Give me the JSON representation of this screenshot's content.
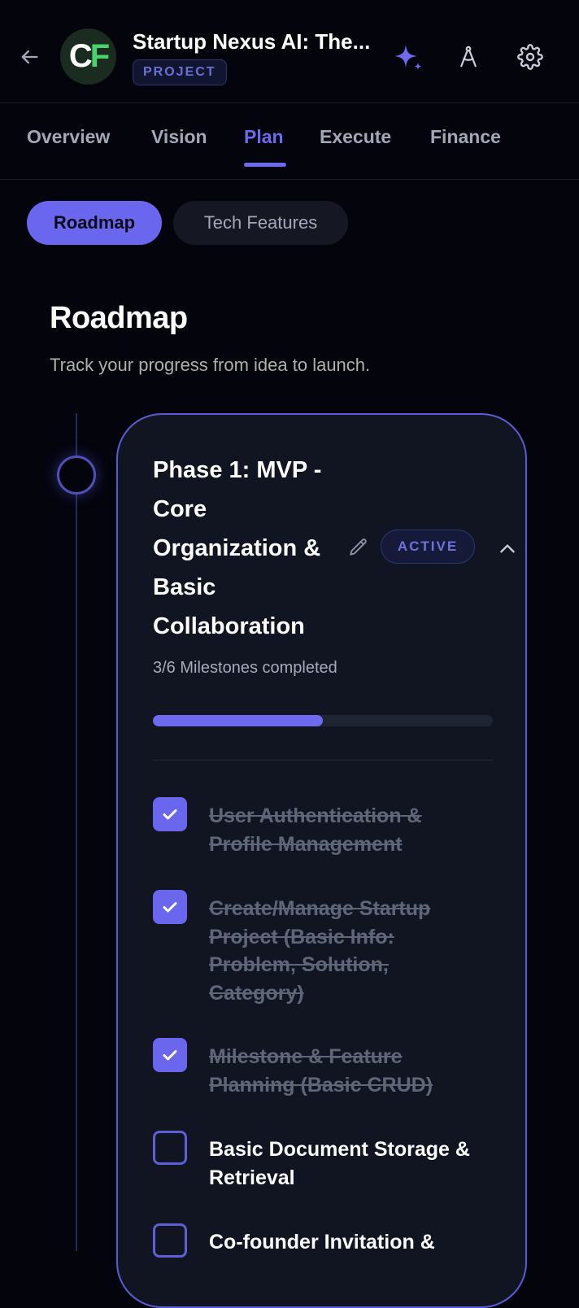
{
  "header": {
    "back_icon": "arrow-left-icon",
    "logo_letters": [
      "C",
      "F"
    ],
    "title": "Startup Nexus AI: The...",
    "badge": "PROJECT",
    "actions": [
      {
        "name": "ai-sparkle-icon",
        "color": "#6e6af0"
      },
      {
        "name": "compass-icon",
        "color": "#c9ccd8"
      },
      {
        "name": "gear-icon",
        "color": "#c9ccd8"
      }
    ]
  },
  "tabs": [
    "Overview",
    "Vision",
    "Plan",
    "Execute",
    "Finance"
  ],
  "active_tab": "Plan",
  "subtabs": [
    "Roadmap",
    "Tech Features"
  ],
  "active_subtab": "Roadmap",
  "section": {
    "title": "Roadmap",
    "subtitle": "Track your progress from idea to launch."
  },
  "phase": {
    "title": "Phase 1: MVP - Core Organization & Basic Collaboration",
    "status": "ACTIVE",
    "milestones_text": "3/6 Milestones completed",
    "progress": 0.5,
    "milestones": [
      {
        "label": "User Authentication & Profile Management",
        "done": true
      },
      {
        "label": "Create/Manage Startup Project (Basic Info: Problem, Solution, Category)",
        "done": true
      },
      {
        "label": "Milestone & Feature Planning (Basic CRUD)",
        "done": true
      },
      {
        "label": "Basic Document Storage & Retrieval",
        "done": false
      },
      {
        "label": "Co-founder Invitation &",
        "done": false
      }
    ]
  },
  "colors": {
    "accent": "#6e6af0",
    "background": "#03040c",
    "card": "#111522",
    "logo_green": "#49d36a"
  }
}
